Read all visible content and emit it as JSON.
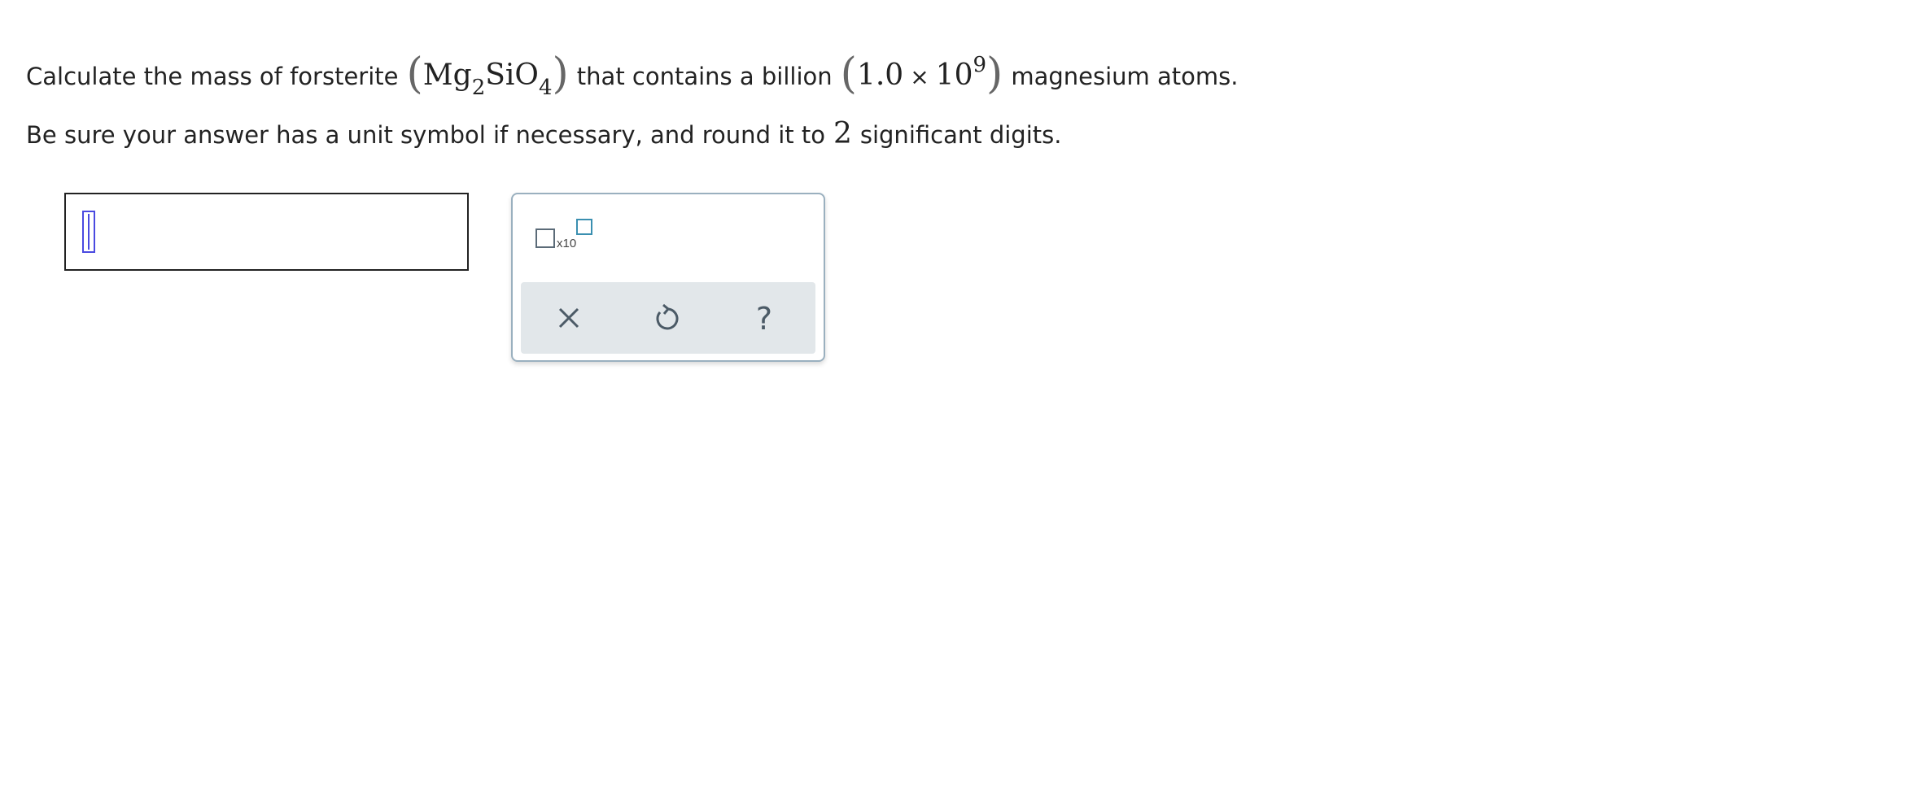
{
  "question": {
    "line1": {
      "prefix": "Calculate the mass of forsterite",
      "formula_mg": "Mg",
      "formula_mg_sub": "2",
      "formula_sio": "SiO",
      "formula_sio_sub": "4",
      "middle": "that contains a billion",
      "number_mantissa": "1.0",
      "number_times": "×",
      "number_base": "10",
      "number_exp": "9",
      "suffix": "magnesium atoms."
    },
    "line2": {
      "prefix": "Be sure your answer has a unit symbol if necessary, and round it to",
      "digits": "2",
      "suffix": "significant digits."
    }
  },
  "answer": {
    "value": ""
  },
  "tools": {
    "sci_notation_label": "x10",
    "clear_icon": "close-icon",
    "undo_icon": "undo-icon",
    "help_icon": "help-icon",
    "help_glyph": "?"
  },
  "colors": {
    "caret": "#4a4ae0",
    "panel_border": "#9ab0bf",
    "action_bar_bg": "#e2e7ea",
    "icon": "#4b5a66",
    "exponent_box": "#3a8fb0"
  }
}
